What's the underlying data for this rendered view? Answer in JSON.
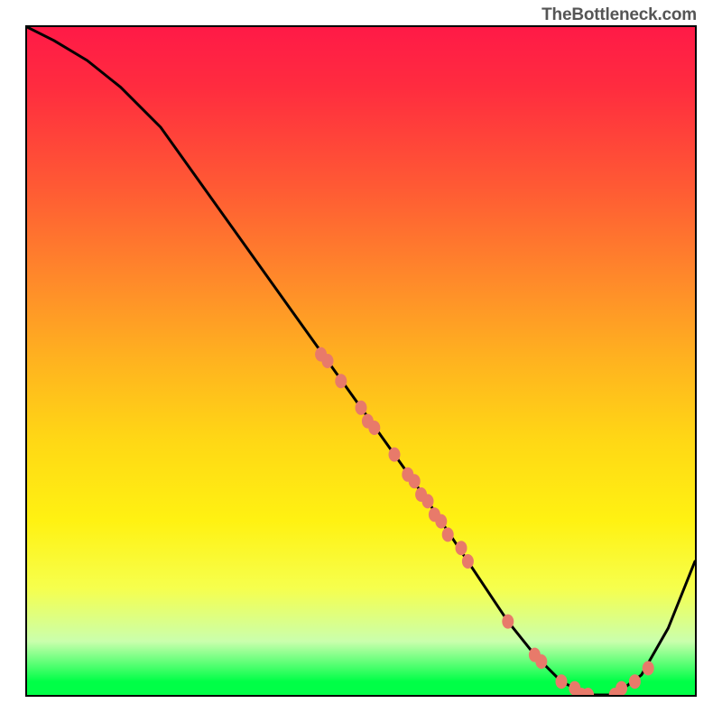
{
  "watermark": "TheBottleneck.com",
  "chart_data": {
    "type": "line",
    "title": "",
    "xlabel": "",
    "ylabel": "",
    "grid": false,
    "legend": false,
    "xlim": [
      0,
      100
    ],
    "ylim": [
      0,
      100
    ],
    "series": [
      {
        "name": "curve",
        "x": [
          0,
          4,
          9,
          14,
          20,
          30,
          40,
          50,
          60,
          66,
          70,
          72,
          76,
          80,
          84,
          88,
          92,
          96,
          100
        ],
        "y": [
          100,
          98,
          95,
          91,
          85,
          71,
          57,
          43,
          29,
          20,
          14,
          11,
          6,
          2,
          0,
          0,
          3,
          10,
          20
        ]
      }
    ],
    "points": [
      {
        "x": 44,
        "y": 51
      },
      {
        "x": 45,
        "y": 50
      },
      {
        "x": 47,
        "y": 47
      },
      {
        "x": 50,
        "y": 43
      },
      {
        "x": 51,
        "y": 41
      },
      {
        "x": 52,
        "y": 40
      },
      {
        "x": 55,
        "y": 36
      },
      {
        "x": 57,
        "y": 33
      },
      {
        "x": 58,
        "y": 32
      },
      {
        "x": 59,
        "y": 30
      },
      {
        "x": 60,
        "y": 29
      },
      {
        "x": 61,
        "y": 27
      },
      {
        "x": 62,
        "y": 26
      },
      {
        "x": 63,
        "y": 24
      },
      {
        "x": 65,
        "y": 22
      },
      {
        "x": 66,
        "y": 20
      },
      {
        "x": 72,
        "y": 11
      },
      {
        "x": 76,
        "y": 6
      },
      {
        "x": 77,
        "y": 5
      },
      {
        "x": 80,
        "y": 2
      },
      {
        "x": 82,
        "y": 1
      },
      {
        "x": 83,
        "y": 0
      },
      {
        "x": 84,
        "y": 0
      },
      {
        "x": 88,
        "y": 0
      },
      {
        "x": 89,
        "y": 1
      },
      {
        "x": 91,
        "y": 2
      },
      {
        "x": 93,
        "y": 4
      }
    ],
    "colors": {
      "curve": "#000000",
      "points": "#e87a6a",
      "gradient_stops": [
        "#ff1a47",
        "#ff5a34",
        "#ffb31f",
        "#fff212",
        "#caffad",
        "#00ff47"
      ]
    }
  }
}
